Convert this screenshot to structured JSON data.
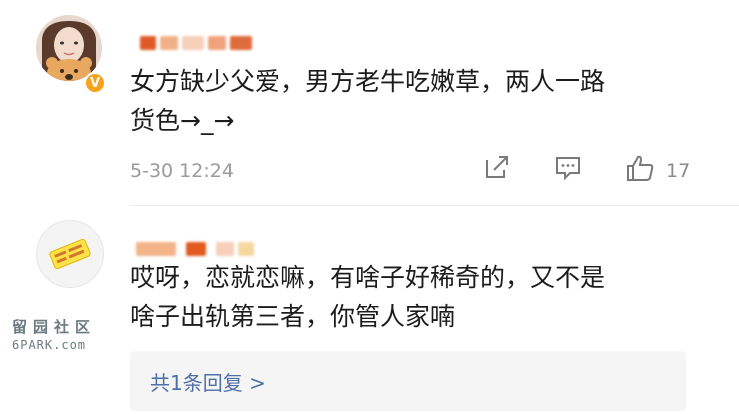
{
  "comments": [
    {
      "text_line1": "女方缺少父爱，男方老牛吃嫩草，两人一路",
      "text_line2": "货色→_→",
      "time": "5-30 12:24",
      "like_count": "17",
      "badge": "V"
    },
    {
      "text_line1": "哎呀，恋就恋嘛，有啥子好稀奇的，又不是",
      "text_line2": "啥子出轨第三者，你管人家喃",
      "replies_label": "共1条回复 >"
    }
  ],
  "watermark": {
    "cn": "留园社区",
    "en": "6PARK.com"
  },
  "colors": {
    "accent_link": "#4f6fa8",
    "badge": "#f6a21a",
    "meta_gray": "#9a9a9a"
  },
  "icons": [
    "share-icon",
    "comment-icon",
    "like-icon"
  ]
}
